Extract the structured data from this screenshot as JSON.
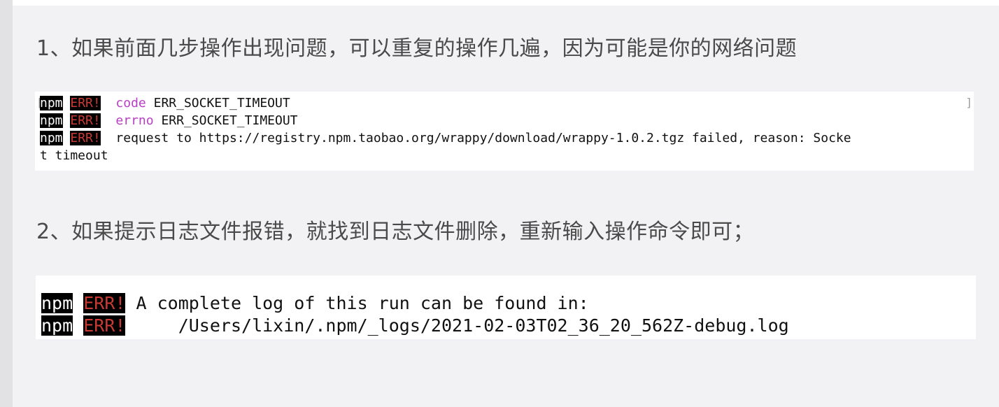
{
  "paragraph1": "1、如果前面几步操作出现问题，可以重复的操作几遍，因为可能是你的网络问题",
  "paragraph2": "2、如果提示日志文件报错，就找到日志文件删除，重新输入操作命令即可；",
  "terminal1": {
    "prefix_npm": "npm",
    "prefix_err": "ERR!",
    "line1_keyword": "code",
    "line1_value": "ERR_SOCKET_TIMEOUT",
    "line2_keyword": "errno",
    "line2_value": "ERR_SOCKET_TIMEOUT",
    "line3_text": "request to https://registry.npm.taobao.org/wrappy/download/wrappy-1.0.2.tgz failed, reason: Socke",
    "line4_text": "t timeout"
  },
  "terminal2": {
    "prefix_npm": "npm",
    "prefix_err": "ERR!",
    "line1_text": "A complete log of this run can be found in:",
    "line2_text": "    /Users/lixin/.npm/_logs/2021-02-03T02_36_20_562Z-debug.log"
  },
  "colors": {
    "err_red": "#c93a32",
    "keyword_purple": "#b93fc4",
    "panel_bg": "#f2f2f4"
  }
}
